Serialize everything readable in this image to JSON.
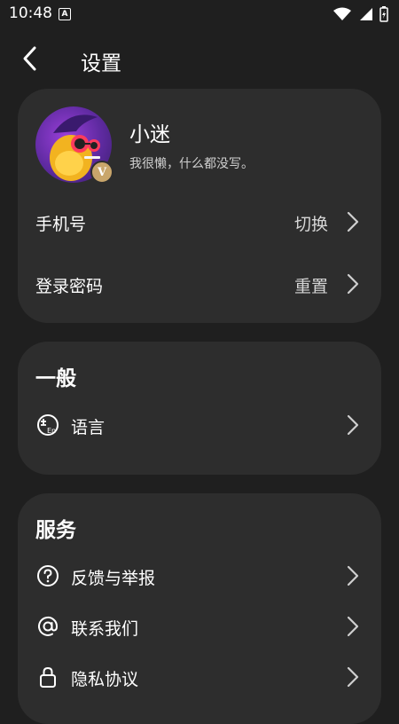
{
  "status_bar": {
    "time": "10:48",
    "notification_letter": "A"
  },
  "header": {
    "title": "设置"
  },
  "profile": {
    "name": "小迷",
    "bio": "我很懒，什么都没写。",
    "vip_letter": "V",
    "rows": [
      {
        "label": "手机号",
        "value": "切换"
      },
      {
        "label": "登录密码",
        "value": "重置"
      }
    ]
  },
  "general": {
    "title": "一般",
    "items": [
      {
        "label": "语言",
        "icon": "language-icon"
      }
    ]
  },
  "service": {
    "title": "服务",
    "items": [
      {
        "label": "反馈与举报",
        "icon": "question-circle-icon"
      },
      {
        "label": "联系我们",
        "icon": "at-sign-icon"
      },
      {
        "label": "隐私协议",
        "icon": "lock-icon"
      }
    ]
  },
  "colors": {
    "background": "#1f1f1f",
    "card": "#2d2d2d",
    "vip_gold": "#c9a66b"
  }
}
